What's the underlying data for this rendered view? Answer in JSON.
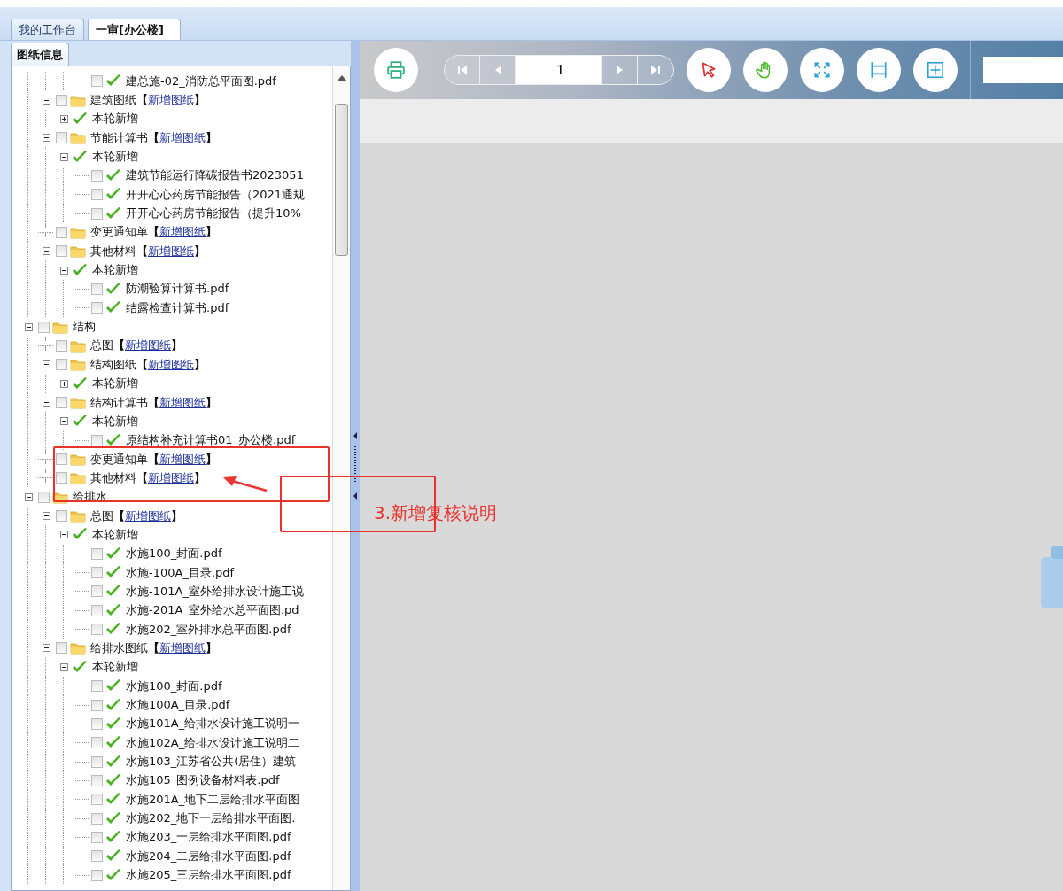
{
  "tabs": [
    {
      "label": "我的工作台",
      "selected": false
    },
    {
      "label": "一审[办公楼]",
      "selected": true
    }
  ],
  "panel": {
    "tabs": [
      {
        "label": "图纸信息",
        "selected": true
      }
    ]
  },
  "tree": [
    {
      "children": [
        {
          "children": [
            {
              "children": [
                {
                  "kind": "file",
                  "label": "建总施-02_消防总平面图.pdf",
                  "checked": false
                }
              ]
            }
          ]
        },
        {
          "kind": "folder",
          "label": "建筑图纸",
          "checked": false,
          "expanded": true,
          "link": {
            "before": "【",
            "text": "新增图纸",
            "after": "】"
          },
          "children": [
            {
              "kind": "group",
              "label": "本轮新增",
              "expanded": false
            }
          ]
        },
        {
          "kind": "folder",
          "label": "节能计算书",
          "checked": false,
          "expanded": true,
          "link": {
            "before": "【",
            "text": "新增图纸",
            "after": "】"
          },
          "children": [
            {
              "kind": "group",
              "label": "本轮新增",
              "expanded": true,
              "children": [
                {
                  "kind": "file",
                  "label": "建筑节能运行降碳报告书2023051",
                  "checked": false
                },
                {
                  "kind": "file",
                  "label": "开开心心药房节能报告（2021通规",
                  "checked": false
                },
                {
                  "kind": "file",
                  "label": "开开心心药房节能报告（提升10%",
                  "checked": false
                }
              ]
            }
          ]
        },
        {
          "kind": "folder",
          "label": "变更通知单",
          "checked": false,
          "link": {
            "before": "【",
            "text": "新增图纸",
            "after": "】"
          }
        },
        {
          "kind": "folder",
          "label": "其他材料",
          "checked": false,
          "expanded": true,
          "link": {
            "before": "【",
            "text": "新增图纸",
            "after": "】"
          },
          "children": [
            {
              "kind": "group",
              "label": "本轮新增",
              "expanded": true,
              "children": [
                {
                  "kind": "file",
                  "label": "防潮验算计算书.pdf",
                  "checked": false
                },
                {
                  "kind": "file",
                  "label": "结露检查计算书.pdf",
                  "checked": false
                }
              ]
            }
          ]
        }
      ]
    },
    {
      "kind": "folder",
      "label": "结构",
      "checked": false,
      "expanded": true,
      "children": [
        {
          "kind": "folder",
          "label": "总图",
          "checked": false,
          "link": {
            "before": "【",
            "text": "新增图纸",
            "after": "】"
          }
        },
        {
          "kind": "folder",
          "label": "结构图纸",
          "checked": false,
          "expanded": true,
          "link": {
            "before": "【",
            "text": "新增图纸",
            "after": "】"
          },
          "children": [
            {
              "kind": "group",
              "label": "本轮新增",
              "expanded": false
            }
          ]
        },
        {
          "kind": "folder",
          "label": "结构计算书",
          "checked": false,
          "expanded": true,
          "link": {
            "before": "【",
            "text": "新增图纸",
            "after": "】"
          },
          "children": [
            {
              "kind": "group",
              "label": "本轮新增",
              "expanded": true,
              "children": [
                {
                  "kind": "file",
                  "label": "原结构补充计算书01_办公楼.pdf",
                  "checked": false
                }
              ]
            }
          ]
        },
        {
          "kind": "folder",
          "label": "变更通知单",
          "checked": false,
          "link": {
            "before": "【",
            "text": "新增图纸",
            "after": "】"
          }
        },
        {
          "kind": "folder",
          "label": "其他材料",
          "checked": false,
          "link": {
            "before": "【",
            "text": "新增图纸",
            "after": "】"
          }
        }
      ]
    },
    {
      "kind": "folder",
      "label": "给排水",
      "checked": false,
      "expanded": true,
      "children": [
        {
          "kind": "folder",
          "label": "总图",
          "checked": false,
          "expanded": true,
          "link": {
            "before": "【",
            "text": "新增图纸",
            "after": "】"
          },
          "children": [
            {
              "kind": "group",
              "label": "本轮新增",
              "expanded": true,
              "children": [
                {
                  "kind": "file",
                  "label": "水施100_封面.pdf",
                  "checked": false
                },
                {
                  "kind": "file",
                  "label": "水施-100A_目录.pdf",
                  "checked": false
                },
                {
                  "kind": "file",
                  "label": "水施-101A_室外给排水设计施工说",
                  "checked": false
                },
                {
                  "kind": "file",
                  "label": "水施-201A_室外给水总平面图.pd",
                  "checked": false
                },
                {
                  "kind": "file",
                  "label": "水施202_室外排水总平面图.pdf",
                  "checked": false
                }
              ]
            }
          ]
        },
        {
          "kind": "folder",
          "label": "给排水图纸",
          "checked": false,
          "expanded": true,
          "link": {
            "before": "【",
            "text": "新增图纸",
            "after": "】"
          },
          "children": [
            {
              "kind": "group",
              "label": "本轮新增",
              "expanded": true,
              "children": [
                {
                  "kind": "file",
                  "label": "水施100_封面.pdf",
                  "checked": false
                },
                {
                  "kind": "file",
                  "label": "水施100A_目录.pdf",
                  "checked": false
                },
                {
                  "kind": "file",
                  "label": "水施101A_给排水设计施工说明一",
                  "checked": false
                },
                {
                  "kind": "file",
                  "label": "水施102A_给排水设计施工说明二",
                  "checked": false
                },
                {
                  "kind": "file",
                  "label": "水施103_江苏省公共(居住）建筑",
                  "checked": false
                },
                {
                  "kind": "file",
                  "label": "水施105_图例设备材料表.pdf",
                  "checked": false
                },
                {
                  "kind": "file",
                  "label": "水施201A_地下二层给排水平面图",
                  "checked": false
                },
                {
                  "kind": "file",
                  "label": "水施202_地下一层给排水平面图.",
                  "checked": false
                },
                {
                  "kind": "file",
                  "label": "水施203_一层给排水平面图.pdf",
                  "checked": false
                },
                {
                  "kind": "file",
                  "label": "水施204_二层给排水平面图.pdf",
                  "checked": false
                },
                {
                  "kind": "file",
                  "label": "水施205_三层给排水平面图.pdf",
                  "checked": false
                }
              ]
            }
          ]
        }
      ]
    }
  ],
  "toolbar": {
    "page": "1"
  },
  "annotation": {
    "text": "3.新增复核说明"
  }
}
